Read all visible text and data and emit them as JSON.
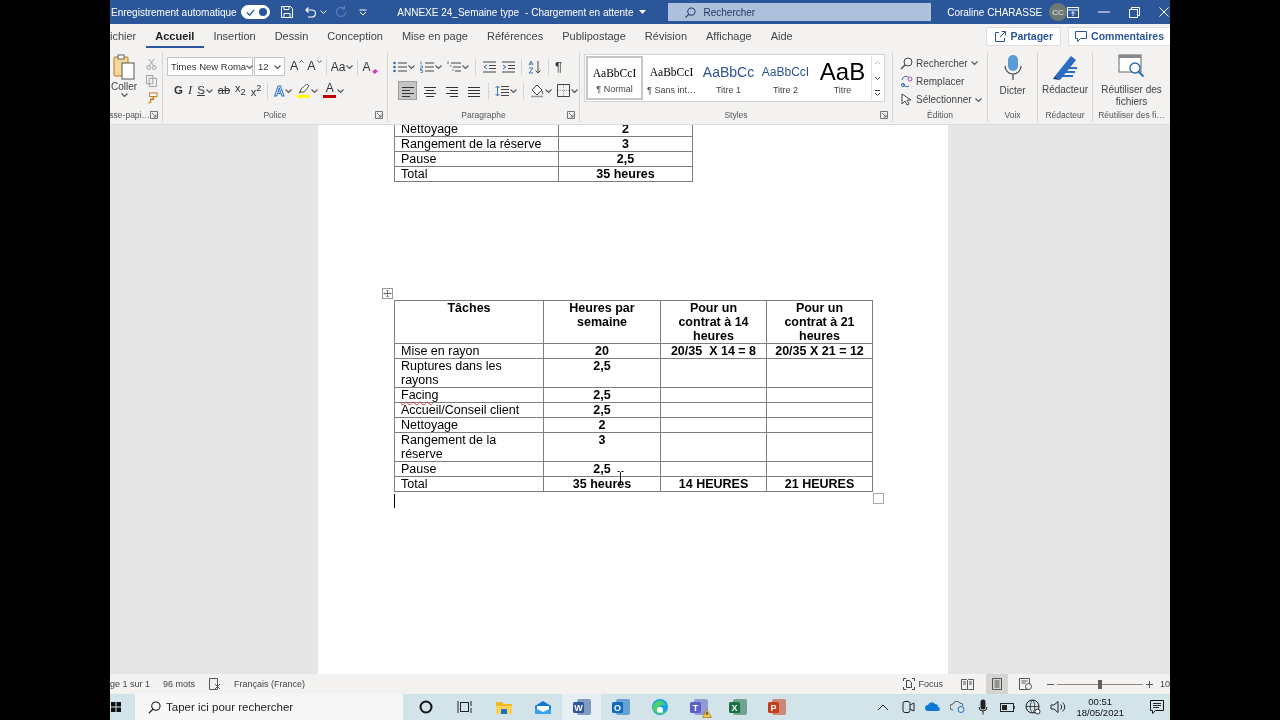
{
  "title_bar": {
    "autosave_label": "Enregistrement automatique",
    "autosave_on": true,
    "redo_disabled": true,
    "document_title": "ANNEXE 24_Semaine type",
    "save_status": "- Chargement en attente",
    "search_placeholder": "Rechercher",
    "user_name": "Coraline CHARASSE",
    "user_initials": "CC"
  },
  "ribbon_tabs": [
    {
      "label": "ichier",
      "selected": false
    },
    {
      "label": "Accueil",
      "selected": true
    },
    {
      "label": "Insertion",
      "selected": false
    },
    {
      "label": "Dessin",
      "selected": false
    },
    {
      "label": "Conception",
      "selected": false
    },
    {
      "label": "Mise en page",
      "selected": false
    },
    {
      "label": "Références",
      "selected": false
    },
    {
      "label": "Publipostage",
      "selected": false
    },
    {
      "label": "Révision",
      "selected": false
    },
    {
      "label": "Affichage",
      "selected": false
    },
    {
      "label": "Aide",
      "selected": false
    }
  ],
  "share_button": "Partager",
  "comments_button": "Commentaires",
  "ribbon": {
    "clipboard": {
      "paste_label": "Coller",
      "group_label": "sse-papi…"
    },
    "font": {
      "font_name": "Times New Roma",
      "font_size": "12",
      "row_1": [
        {
          "kind": "grow",
          "glyph": "A",
          "has_menu": false
        },
        {
          "kind": "shrink",
          "glyph": "A",
          "has_menu": false
        },
        {
          "kind": "case",
          "glyph": "Aa",
          "has_menu": true
        },
        {
          "kind": "clear",
          "glyph": "A",
          "has_menu": false
        }
      ],
      "row_2": [
        {
          "kind": "bold",
          "glyph": "G",
          "has_menu": false
        },
        {
          "kind": "italic",
          "glyph": "I",
          "has_menu": false
        },
        {
          "kind": "underline",
          "glyph": "S",
          "has_menu": true
        },
        {
          "kind": "strike",
          "glyph": "ab",
          "has_menu": false
        },
        {
          "kind": "subscript",
          "glyph": "x$_{2}$",
          "has_menu": false
        },
        {
          "kind": "superscript",
          "glyph": "x$^{2}$",
          "has_menu": false
        },
        {
          "kind": "effects",
          "glyph": "A",
          "has_menu": true
        },
        {
          "kind": "highlight",
          "color": "#ffff00",
          "has_menu": true
        },
        {
          "kind": "font_color",
          "glyph": "A",
          "color": "#c00000",
          "has_menu": true
        }
      ],
      "group_label": "Police"
    },
    "paragraph": {
      "row_1": [
        {
          "kind": "bullets",
          "has_menu": true
        },
        {
          "kind": "numbering",
          "has_menu": true
        },
        {
          "kind": "multilevel",
          "has_menu": true
        },
        {
          "kind": "outdent",
          "has_menu": false
        },
        {
          "kind": "indent",
          "has_menu": false
        },
        {
          "kind": "sort",
          "has_menu": false
        },
        {
          "kind": "pilcrow",
          "glyph": "¶",
          "has_menu": false
        }
      ],
      "alignment": [
        {
          "kind": "left",
          "selected": true
        },
        {
          "kind": "center",
          "selected": false
        },
        {
          "kind": "right",
          "selected": false
        },
        {
          "kind": "justify",
          "selected": false
        }
      ],
      "row_2": [
        {
          "kind": "line_spacing",
          "has_menu": true
        },
        {
          "kind": "shading",
          "has_menu": true
        },
        {
          "kind": "borders",
          "has_menu": true
        }
      ],
      "group_label": "Paragraphe"
    },
    "styles": {
      "items": [
        {
          "kind": "normal",
          "preview": "AaBbCcI",
          "name": "¶ Normal",
          "selected": true
        },
        {
          "kind": "no_spacing",
          "preview": "AaBbCcI",
          "name": "¶ Sans int…",
          "selected": false
        },
        {
          "kind": "heading_1",
          "preview": "AaBbCc",
          "name": "Titre 1",
          "selected": false
        },
        {
          "kind": "heading_2",
          "preview": "AaBbCcI",
          "name": "Titre 2",
          "selected": false
        },
        {
          "kind": "title",
          "preview": "AaB",
          "name": "Titre",
          "selected": false
        }
      ],
      "group_label": "Styles"
    },
    "editing": {
      "items": [
        {
          "kind": "find",
          "label": "Rechercher",
          "has_menu": true
        },
        {
          "kind": "replace",
          "label": "Remplacer",
          "has_menu": false
        },
        {
          "kind": "select",
          "label": "Sélectionner",
          "has_menu": true
        }
      ],
      "group_label": "Édition"
    },
    "big_groups": [
      {
        "kind": "dictate",
        "button": "Dicter",
        "group_label": "Voix"
      },
      {
        "kind": "editor",
        "button": "Rédacteur",
        "group_label": "Rédacteur"
      },
      {
        "kind": "reuse",
        "button": "Réutiliser des fichiers",
        "group_label": "Réutiliser des fi…"
      }
    ]
  },
  "document": {
    "tables": [
      {
        "rows": [
          {
            "cells": [
              "Nettoyage",
              "2"
            ],
            "misspelled": false
          },
          {
            "cells": [
              "Rangement de la réserve",
              "3"
            ],
            "misspelled": false
          },
          {
            "cells": [
              "Pause",
              "2,5"
            ],
            "misspelled": false
          },
          {
            "cells": [
              "Total",
              "35 heures"
            ],
            "misspelled": false
          }
        ]
      },
      {
        "columns": [
          "Tâches",
          "Heures par semaine",
          "Pour un contrat à 14 heures",
          "Pour un contrat à 21 heures"
        ],
        "rows": [
          {
            "cells": [
              "Mise en rayon",
              "20",
              "20/35  X 14 = 8",
              "20/35 X 21 = 12"
            ],
            "misspelled": false
          },
          {
            "cells": [
              "Ruptures dans les rayons",
              "2,5"
            ],
            "misspelled": false
          },
          {
            "cells": [
              "Facing",
              "2,5"
            ],
            "misspelled": true
          },
          {
            "cells": [
              "Accueil/Conseil client",
              "2,5"
            ],
            "misspelled": false
          },
          {
            "cells": [
              "Nettoyage",
              "2"
            ],
            "misspelled": false
          },
          {
            "cells": [
              "Rangement de la réserve",
              "3"
            ],
            "misspelled": false
          },
          {
            "cells": [
              "Pause",
              "2,5"
            ],
            "misspelled": false
          },
          {
            "cells": [
              "Total",
              "35 heures",
              "14 HEURES",
              "21 HEURES"
            ],
            "misspelled": false
          }
        ]
      }
    ]
  },
  "status_bar": {
    "page": "ge 1 sur 1",
    "words": "96 mots",
    "language": "Français (France)",
    "focus": "Focus",
    "views": [
      {
        "kind": "read",
        "selected": false
      },
      {
        "kind": "print",
        "selected": true
      },
      {
        "kind": "web",
        "selected": false
      }
    ],
    "zoom_slider": {
      "level": 0.5
    },
    "zoom": "10"
  },
  "taskbar": {
    "search_placeholder": "Taper ici pour rechercher",
    "apps": [
      {
        "kind": "cortana",
        "active": false
      },
      {
        "kind": "task_view",
        "active": false
      },
      {
        "kind": "explorer",
        "active": false
      },
      {
        "kind": "mail",
        "active": false
      },
      {
        "kind": "word",
        "glyph": "W",
        "active": true
      },
      {
        "kind": "outlook",
        "glyph": "O",
        "active": false
      },
      {
        "kind": "edge",
        "active": false
      },
      {
        "kind": "teams",
        "glyph": "T",
        "active": false
      },
      {
        "kind": "excel",
        "glyph": "X",
        "active": false
      },
      {
        "kind": "powerpoint",
        "glyph": "P",
        "active": false
      }
    ],
    "tray": [
      {
        "kind": "chevron"
      },
      {
        "kind": "meet"
      },
      {
        "kind": "onedrive"
      },
      {
        "kind": "sync"
      },
      {
        "kind": "mic"
      },
      {
        "kind": "battery"
      },
      {
        "kind": "network"
      },
      {
        "kind": "volume"
      }
    ],
    "time": "00:51",
    "date": "18/05/2021"
  }
}
